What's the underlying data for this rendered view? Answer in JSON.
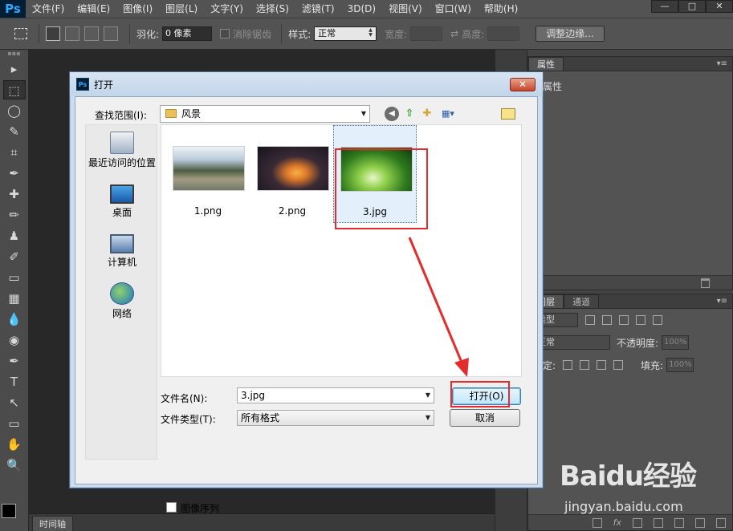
{
  "app": {
    "logo": "Ps"
  },
  "menubar": {
    "items": [
      "文件(F)",
      "编辑(E)",
      "图像(I)",
      "图层(L)",
      "文字(Y)",
      "选择(S)",
      "滤镜(T)",
      "3D(D)",
      "视图(V)",
      "窗口(W)",
      "帮助(H)"
    ]
  },
  "window_controls": {
    "minimize": "—",
    "restore": "□",
    "close": "✕"
  },
  "options": {
    "feather_label": "羽化:",
    "feather_value": "0 像素",
    "antialias_label": "消除锯齿",
    "style_label": "样式:",
    "style_value": "正常",
    "width_label": "宽度:",
    "swap_icon": "⇄",
    "height_label": "高度:",
    "refine_edge": "调整边缘..."
  },
  "tools": [
    "▸",
    "⬚",
    "◯",
    "✎",
    "⌗",
    "✒",
    "✚",
    "✏",
    "♟",
    "✐",
    "▭",
    "▦",
    "💧",
    "◉",
    "✒",
    "T",
    "↖",
    "▭",
    "✋",
    "🔍"
  ],
  "panels": {
    "properties_tab": "属性",
    "properties_title": "属性",
    "layers_tab": "图层",
    "channels_tab": "通道",
    "kind_filter": "类型",
    "blend_mode": "正常",
    "opacity_label": "不透明度:",
    "opacity_value": "100%",
    "lock_label": "锁定:",
    "fill_label": "填充:",
    "fill_value": "100%",
    "fx_label": "fx",
    "menu_glyph": "▾≡"
  },
  "timeline": {
    "tab": "时间轴"
  },
  "dialog": {
    "title": "打开",
    "close": "✕",
    "look_in_label": "查找范围(I):",
    "look_in_value": "风景",
    "places": [
      {
        "label": "最近访问的位置",
        "icon": "recent-places-icon"
      },
      {
        "label": "桌面",
        "icon": "desktop-icon"
      },
      {
        "label": "计算机",
        "icon": "computer-icon"
      },
      {
        "label": "网络",
        "icon": "network-icon"
      }
    ],
    "files": [
      {
        "name": "1.png",
        "selected": false
      },
      {
        "name": "2.png",
        "selected": false
      },
      {
        "name": "3.jpg",
        "selected": true
      }
    ],
    "filename_label": "文件名(N):",
    "filename_value": "3.jpg",
    "filetype_label": "文件类型(T):",
    "filetype_value": "所有格式",
    "open_button": "打开(O)",
    "cancel_button": "取消",
    "image_sequence_label": "图像序列"
  },
  "watermark": {
    "logo": "Baidu经验",
    "url": "jingyan.baidu.com"
  },
  "colors": {
    "annotation_red": "#e52b2b",
    "ps_chrome": "#535353",
    "dialog_frame": "#cfdcec"
  }
}
